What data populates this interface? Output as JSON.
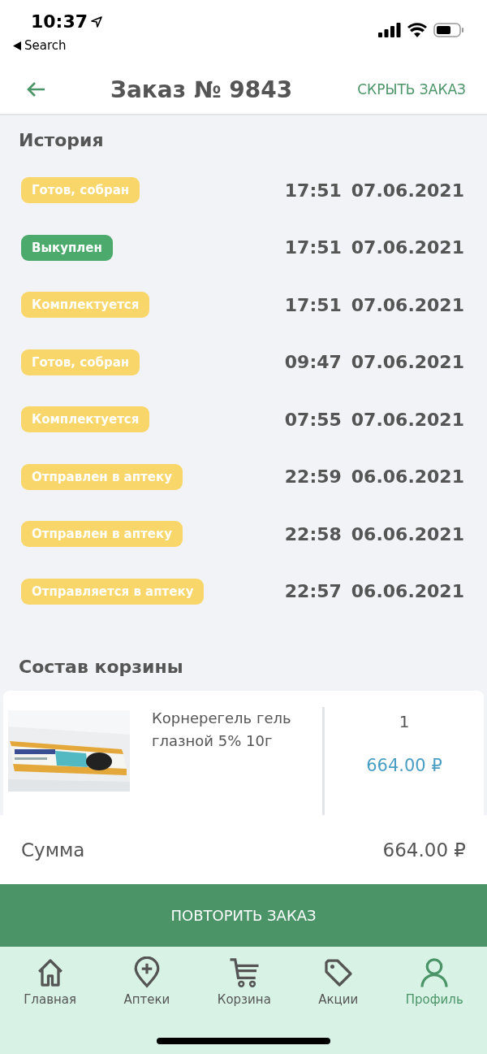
{
  "status_bar": {
    "time": "10:37",
    "back_label": "Search"
  },
  "header": {
    "title": "Заказ № 9843",
    "action": "СКРЫТЬ ЗАКАЗ"
  },
  "history": {
    "title": "История",
    "events": [
      {
        "status": "Готов, собран",
        "color": "#f8d66a",
        "time": "17:51",
        "date": "07.06.2021"
      },
      {
        "status": "Выкуплен",
        "color": "#4caa6c",
        "time": "17:51",
        "date": "07.06.2021"
      },
      {
        "status": "Комплектуется",
        "color": "#f8d66a",
        "time": "17:51",
        "date": "07.06.2021"
      },
      {
        "status": "Готов, собран",
        "color": "#f8d66a",
        "time": "09:47",
        "date": "07.06.2021"
      },
      {
        "status": "Комплектуется",
        "color": "#f8d66a",
        "time": "07:55",
        "date": "07.06.2021"
      },
      {
        "status": "Отправлен в аптеку",
        "color": "#f8d66a",
        "time": "22:59",
        "date": "06.06.2021"
      },
      {
        "status": "Отправлен в аптеку",
        "color": "#f8d66a",
        "time": "22:58",
        "date": "06.06.2021"
      },
      {
        "status": "Отправляется в аптеку",
        "color": "#f8d66a",
        "time": "22:57",
        "date": "06.06.2021"
      }
    ]
  },
  "cart": {
    "title": "Состав корзины",
    "items": [
      {
        "name": "Корнерегель гель глазной 5% 10г",
        "quantity": "1",
        "price": "664.00 ₽"
      }
    ]
  },
  "total": {
    "label": "Сумма",
    "value": "664.00 ₽"
  },
  "repeat_button": "ПОВТОРИТЬ ЗАКАЗ",
  "tab_bar": [
    {
      "kind": "home",
      "label": "Главная",
      "selected": false
    },
    {
      "kind": "pin",
      "label": "Аптеки",
      "selected": false
    },
    {
      "kind": "cart",
      "label": "Корзина",
      "selected": false
    },
    {
      "kind": "tag",
      "label": "Акции",
      "selected": false
    },
    {
      "kind": "profile",
      "label": "Профиль",
      "selected": true
    }
  ]
}
